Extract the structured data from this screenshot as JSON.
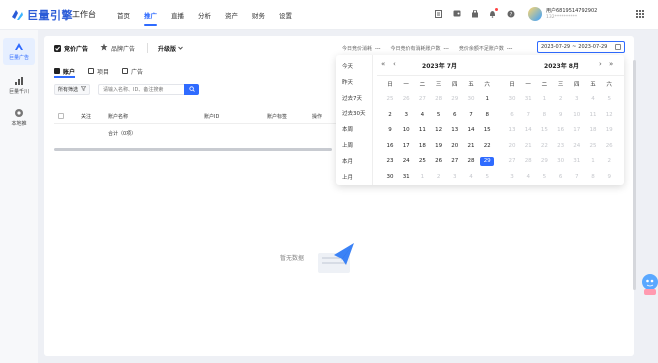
{
  "colors": {
    "accent": "#2f6bff",
    "logo": "#2a5bd7"
  },
  "app": {
    "logo_text": "巨量引擎",
    "workbench": "工作台"
  },
  "topnav": [
    {
      "label": "首页",
      "active": false
    },
    {
      "label": "推广",
      "active": true
    },
    {
      "label": "直播",
      "active": false
    },
    {
      "label": "分析",
      "active": false
    },
    {
      "label": "资产",
      "active": false
    },
    {
      "label": "财务",
      "active": false
    },
    {
      "label": "设置",
      "active": false
    }
  ],
  "top_icons": [
    "doc-icon",
    "wallet-icon",
    "bag-icon",
    "bell-icon",
    "help-icon"
  ],
  "user": {
    "name": "用户6819514792902",
    "sub": "132**********"
  },
  "sidebar": [
    {
      "label": "巨量广告",
      "icon": "ocean-icon",
      "active": true
    },
    {
      "label": "巨量千川",
      "icon": "bar-chart-icon",
      "active": false
    },
    {
      "label": "本地推",
      "icon": "location-icon",
      "active": false
    }
  ],
  "ad_tabs": {
    "bid": "竞价广告",
    "brand": "品牌广告",
    "upgrade": "升级版"
  },
  "stats": [
    {
      "label": "今日竞价消耗",
      "value": "---"
    },
    {
      "label": "今日竞价有消耗账户数",
      "value": "---"
    },
    {
      "label": "竞价余额不足账户数",
      "value": "---"
    }
  ],
  "date_range": {
    "start": "2023-07-29",
    "sep": "~",
    "end": "2023-07-29"
  },
  "sub_tabs": [
    {
      "label": "账户",
      "active": true
    },
    {
      "label": "项目",
      "active": false
    },
    {
      "label": "广告",
      "active": false
    }
  ],
  "filter": {
    "label": "所有筛选",
    "search_placeholder": "请输入名称、ID、备注搜索"
  },
  "table": {
    "headers": [
      "关注",
      "账户名称",
      "账户ID",
      "账户标签",
      "操作"
    ],
    "total_label": "合计（0项）"
  },
  "empty": {
    "text": "暂无数据"
  },
  "calendar": {
    "shortcuts": [
      "今天",
      "昨天",
      "过去7天",
      "过去30天",
      "本周",
      "上周",
      "本月",
      "上月"
    ],
    "weekdays": [
      "日",
      "一",
      "二",
      "三",
      "四",
      "五",
      "六"
    ],
    "left": {
      "title": "2023年 7月",
      "rows": [
        [
          "25",
          "26",
          "27",
          "28",
          "29",
          "30",
          "1"
        ],
        [
          "2",
          "3",
          "4",
          "5",
          "6",
          "7",
          "8"
        ],
        [
          "9",
          "10",
          "11",
          "12",
          "13",
          "14",
          "15"
        ],
        [
          "16",
          "17",
          "18",
          "19",
          "20",
          "21",
          "22"
        ],
        [
          "23",
          "24",
          "25",
          "26",
          "27",
          "28",
          "29"
        ],
        [
          "30",
          "31",
          "1",
          "2",
          "3",
          "4",
          "5"
        ]
      ]
    },
    "right": {
      "title": "2023年 8月",
      "rows": [
        [
          "30",
          "31",
          "1",
          "2",
          "3",
          "4",
          "5"
        ],
        [
          "6",
          "7",
          "8",
          "9",
          "10",
          "11",
          "12"
        ],
        [
          "13",
          "14",
          "15",
          "16",
          "17",
          "18",
          "19"
        ],
        [
          "20",
          "21",
          "22",
          "23",
          "24",
          "25",
          "26"
        ],
        [
          "27",
          "28",
          "29",
          "30",
          "31",
          "1",
          "2"
        ],
        [
          "3",
          "4",
          "5",
          "6",
          "7",
          "8",
          "9"
        ]
      ]
    },
    "selected": "29"
  }
}
